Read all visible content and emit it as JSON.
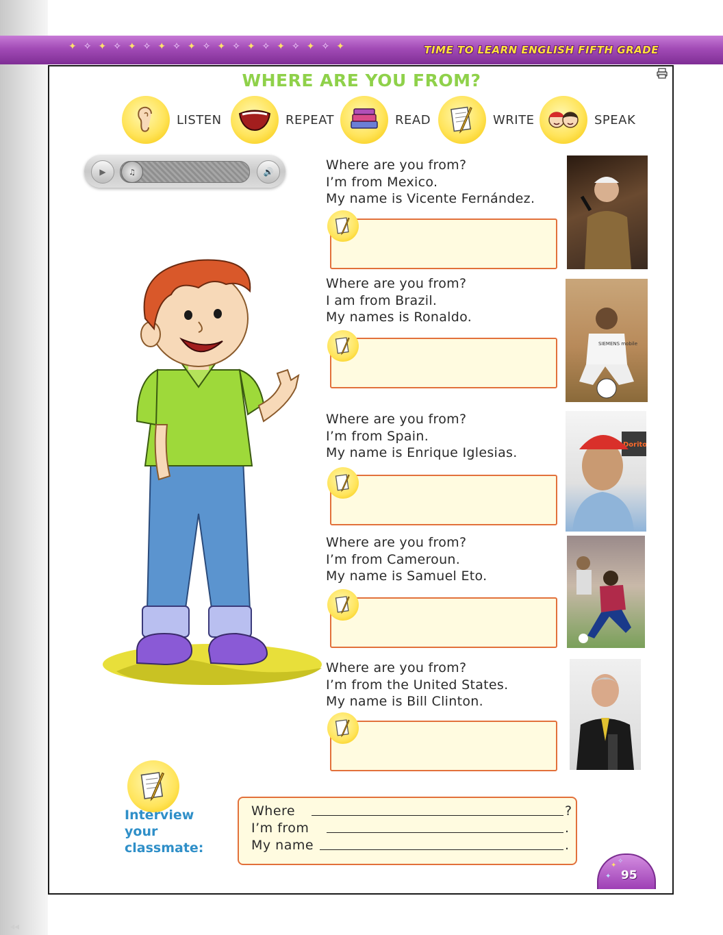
{
  "header": {
    "band_title": "TIME TO LEARN ENGLISH FIFTH GRADE"
  },
  "page": {
    "title": "WHERE ARE YOU FROM?",
    "number": "95"
  },
  "skills": [
    {
      "label": "LISTEN",
      "icon": "ear-icon"
    },
    {
      "label": "REPEAT",
      "icon": "mouth-icon"
    },
    {
      "label": "READ",
      "icon": "books-icon"
    },
    {
      "label": "WRITE",
      "icon": "pencil-paper-icon"
    },
    {
      "label": "SPEAK",
      "icon": "children-icon"
    }
  ],
  "dialogues": [
    {
      "lines": [
        "Where are you from?",
        "I’m from Mexico.",
        "My name is Vicente Fernández."
      ]
    },
    {
      "lines": [
        "Where are you from?",
        "I am from Brazil.",
        "My names is Ronaldo."
      ],
      "photo_text": "SIEMENS mobile"
    },
    {
      "lines": [
        "Where are you from?",
        "I’m from Spain.",
        "My name is Enrique Iglesias."
      ],
      "photo_text": "Dorito"
    },
    {
      "lines": [
        "Where are you from?",
        "I’m from Cameroun.",
        "My name is Samuel Eto."
      ]
    },
    {
      "lines": [
        "Where are you from?",
        "I’m from the United States.",
        "My name is Bill Clinton."
      ]
    }
  ],
  "interview": {
    "label_line1": "Interview your",
    "label_line2": "classmate:",
    "line1": "Where",
    "line1_end": "?",
    "line2": "I’m from",
    "line2_end": ".",
    "line3": "My name",
    "line3_end": "."
  },
  "colors": {
    "title_green": "#8fd14a",
    "header_purple": "#a24bb6",
    "header_text": "#ffe23a",
    "box_border": "#e2703a",
    "box_fill": "#fffbe0",
    "interview_blue": "#2f8fc8"
  }
}
